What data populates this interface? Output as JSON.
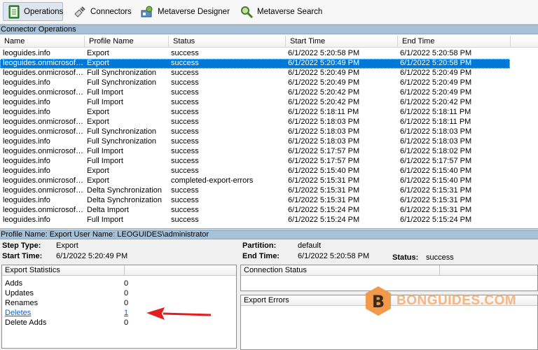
{
  "toolbar": {
    "items": [
      {
        "label": "Operations",
        "icon": "operations-icon"
      },
      {
        "label": "Connectors",
        "icon": "connectors-icon"
      },
      {
        "label": "Metaverse Designer",
        "icon": "metaverse-designer-icon"
      },
      {
        "label": "Metaverse Search",
        "icon": "metaverse-search-icon"
      }
    ],
    "active": "Operations"
  },
  "connector_operations": {
    "title": "Connector Operations",
    "columns": [
      "Name",
      "Profile Name",
      "Status",
      "Start Time",
      "End Time"
    ],
    "selected_row": 1,
    "rows": [
      [
        "leoguides.info",
        "Export",
        "success",
        "6/1/2022 5:20:58 PM",
        "6/1/2022 5:20:58 PM"
      ],
      [
        "leoguides.onmicrosoft....",
        "Export",
        "success",
        "6/1/2022 5:20:49 PM",
        "6/1/2022 5:20:58 PM"
      ],
      [
        "leoguides.onmicrosoft....",
        "Full Synchronization",
        "success",
        "6/1/2022 5:20:49 PM",
        "6/1/2022 5:20:49 PM"
      ],
      [
        "leoguides.info",
        "Full Synchronization",
        "success",
        "6/1/2022 5:20:49 PM",
        "6/1/2022 5:20:49 PM"
      ],
      [
        "leoguides.onmicrosoft....",
        "Full Import",
        "success",
        "6/1/2022 5:20:42 PM",
        "6/1/2022 5:20:49 PM"
      ],
      [
        "leoguides.info",
        "Full Import",
        "success",
        "6/1/2022 5:20:42 PM",
        "6/1/2022 5:20:42 PM"
      ],
      [
        "leoguides.info",
        "Export",
        "success",
        "6/1/2022 5:18:11 PM",
        "6/1/2022 5:18:11 PM"
      ],
      [
        "leoguides.onmicrosoft....",
        "Export",
        "success",
        "6/1/2022 5:18:03 PM",
        "6/1/2022 5:18:11 PM"
      ],
      [
        "leoguides.onmicrosoft....",
        "Full Synchronization",
        "success",
        "6/1/2022 5:18:03 PM",
        "6/1/2022 5:18:03 PM"
      ],
      [
        "leoguides.info",
        "Full Synchronization",
        "success",
        "6/1/2022 5:18:03 PM",
        "6/1/2022 5:18:03 PM"
      ],
      [
        "leoguides.onmicrosoft....",
        "Full Import",
        "success",
        "6/1/2022 5:17:57 PM",
        "6/1/2022 5:18:02 PM"
      ],
      [
        "leoguides.info",
        "Full Import",
        "success",
        "6/1/2022 5:17:57 PM",
        "6/1/2022 5:17:57 PM"
      ],
      [
        "leoguides.info",
        "Export",
        "success",
        "6/1/2022 5:15:40 PM",
        "6/1/2022 5:15:40 PM"
      ],
      [
        "leoguides.onmicrosoft....",
        "Export",
        "completed-export-errors",
        "6/1/2022 5:15:31 PM",
        "6/1/2022 5:15:40 PM"
      ],
      [
        "leoguides.onmicrosoft....",
        "Delta Synchronization",
        "success",
        "6/1/2022 5:15:31 PM",
        "6/1/2022 5:15:31 PM"
      ],
      [
        "leoguides.info",
        "Delta Synchronization",
        "success",
        "6/1/2022 5:15:31 PM",
        "6/1/2022 5:15:31 PM"
      ],
      [
        "leoguides.onmicrosoft....",
        "Delta Import",
        "success",
        "6/1/2022 5:15:24 PM",
        "6/1/2022 5:15:31 PM"
      ],
      [
        "leoguides.info",
        "Full Import",
        "success",
        "6/1/2022 5:15:24 PM",
        "6/1/2022 5:15:24 PM"
      ]
    ]
  },
  "profile_bar": "Profile Name: Export  User Name: LEOGUIDES\\administrator",
  "details": {
    "step_type_label": "Step Type:",
    "step_type": "Export",
    "start_time_label": "Start Time:",
    "start_time": "6/1/2022 5:20:49 PM",
    "partition_label": "Partition:",
    "partition": "default",
    "end_time_label": "End Time:",
    "end_time": "6/1/2022 5:20:58 PM",
    "status_label": "Status:",
    "status": "success"
  },
  "export_statistics": {
    "title": "Export Statistics",
    "rows": [
      {
        "label": "Adds",
        "value": "0"
      },
      {
        "label": "Updates",
        "value": "0"
      },
      {
        "label": "Renames",
        "value": "0"
      },
      {
        "label": "Deletes",
        "value": "1"
      },
      {
        "label": "Delete Adds",
        "value": "0"
      }
    ]
  },
  "connection_status": {
    "title": "Connection Status"
  },
  "export_errors": {
    "title": "Export Errors"
  },
  "watermark": {
    "text": "BONGUIDES.COM",
    "letter": "B"
  },
  "colors": {
    "selection": "#0078d7",
    "header_bar": "#a7c1d9",
    "arrow": "#e02020",
    "watermark": "#f5a05a"
  }
}
